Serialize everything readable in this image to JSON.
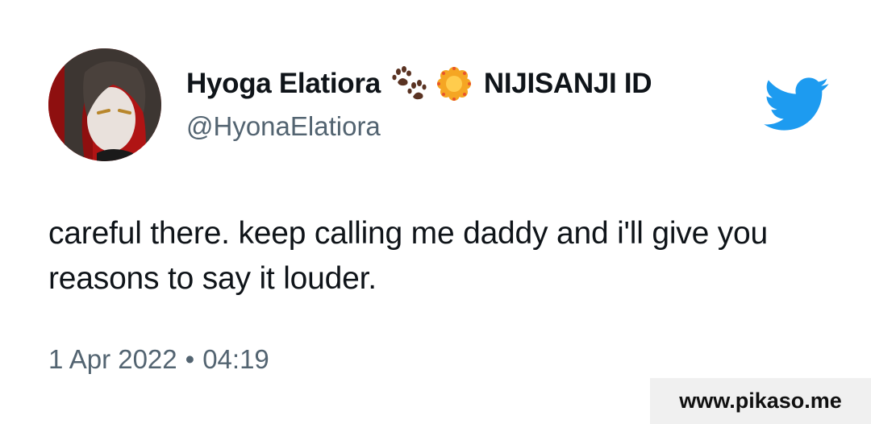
{
  "author": {
    "display_name_part1": "Hyoga Elatiora",
    "display_name_part2": "NIJISANJI ID",
    "handle": "@HyonaElatiora",
    "name_icons": [
      "paw-prints-icon",
      "flower-icon"
    ],
    "avatar": "avatar-image"
  },
  "tweet": {
    "text": "careful there. keep calling me daddy and i'll give you reasons to say it louder.",
    "date": "1 Apr 2022",
    "separator": "•",
    "time": "04:19"
  },
  "brand": {
    "icon": "twitter-bird-icon",
    "color": "#1d9bf0"
  },
  "watermark": {
    "text": "www.pikaso.me"
  }
}
